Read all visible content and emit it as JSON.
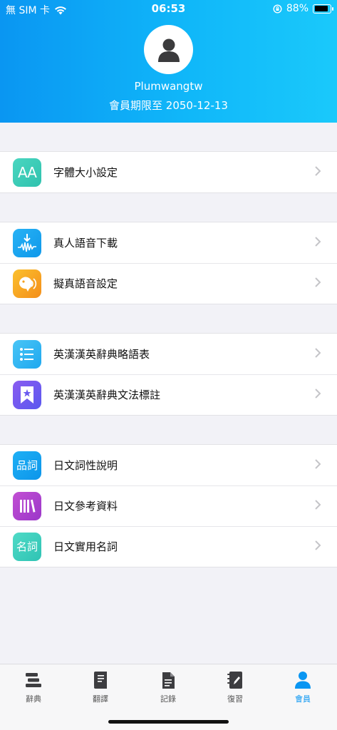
{
  "status_bar": {
    "carrier": "無 SIM 卡",
    "time": "06:53",
    "battery_percent": "88%",
    "battery_level": 0.88
  },
  "profile": {
    "username": "Plumwangtw",
    "expiry": "會員期限至 2050-12-13"
  },
  "groups": [
    {
      "items": [
        {
          "label": "字體大小設定",
          "icon": "font-size-icon",
          "color": "#3ccfb6"
        }
      ]
    },
    {
      "items": [
        {
          "label": "真人語音下載",
          "icon": "voice-download-icon",
          "color": "#14a6f0"
        },
        {
          "label": "擬真語音設定",
          "icon": "voice-settings-icon",
          "color": "#f6a821"
        }
      ]
    },
    {
      "items": [
        {
          "label": "英漢漢英辭典略語表",
          "icon": "list-icon",
          "color": "#32b8f2"
        },
        {
          "label": "英漢漢英辭典文法標註",
          "icon": "bookmark-star-icon",
          "color": "#6b5cf0"
        }
      ]
    },
    {
      "items": [
        {
          "label": "日文詞性說明",
          "icon": "part-of-speech-icon",
          "color": "#13a5f0"
        },
        {
          "label": "日文參考資料",
          "icon": "books-icon",
          "color": "#b044d0"
        },
        {
          "label": "日文實用名詞",
          "icon": "nouns-icon",
          "color": "#3dd2bf"
        }
      ]
    }
  ],
  "icon_text": {
    "font_size": "AA",
    "part_of_speech": "品詞",
    "nouns": "名詞"
  },
  "tabs": [
    {
      "label": "辭典",
      "icon": "dictionary-icon"
    },
    {
      "label": "翻譯",
      "icon": "translate-icon"
    },
    {
      "label": "記錄",
      "icon": "record-icon"
    },
    {
      "label": "復習",
      "icon": "review-icon"
    },
    {
      "label": "會員",
      "icon": "member-icon",
      "active": true
    }
  ],
  "colors": {
    "header_start": "#0a96f2",
    "header_end": "#1ac9fb",
    "active_tab": "#0a96f2"
  }
}
